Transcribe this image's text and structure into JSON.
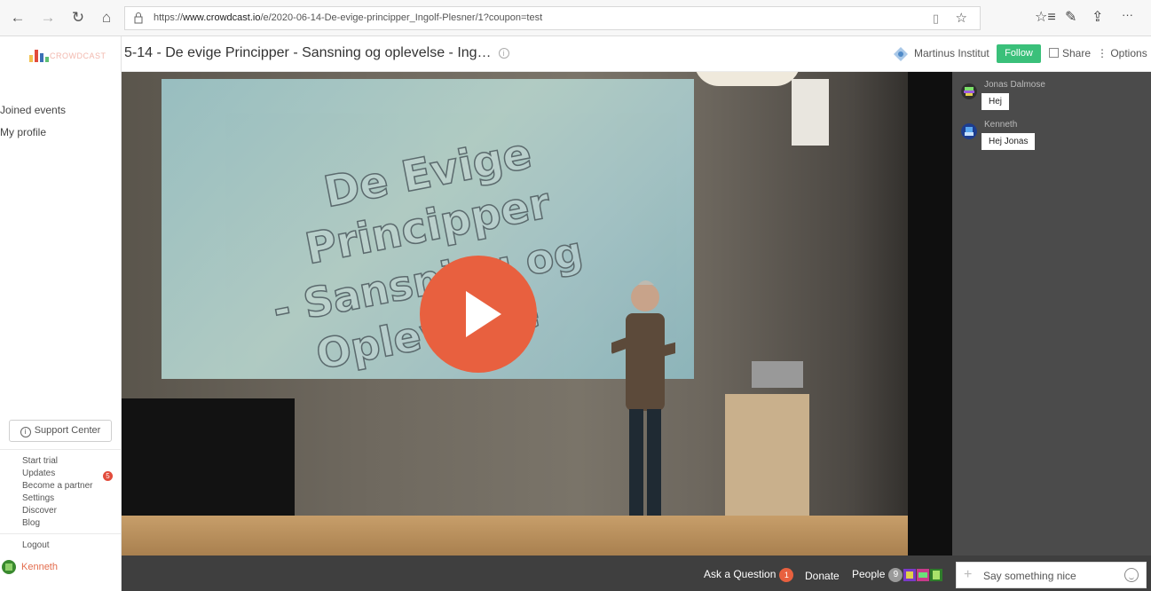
{
  "browser": {
    "back": "←",
    "forward": "→",
    "refresh": "↻",
    "home": "⌂",
    "url_prefix": "https://",
    "url_domain": "www.crowdcast.io",
    "url_path": "/e/2020-06-14-De-evige-principper_Ingolf-Plesner/1?coupon=test",
    "reading_view": "▯",
    "favorite": "☆",
    "favorites_hub": "☆≡",
    "pen": "✎",
    "share": "⇪",
    "more": "···"
  },
  "header": {
    "title": "5-14 - De evige Principper - Sansning og oplevelse - Ing…",
    "info": "i",
    "host_name": "Martinus Institut",
    "follow_label": "Follow",
    "share_label": "Share",
    "options_label": "Options"
  },
  "sidebar": {
    "logo_text": "CROWDCAST",
    "nav": [
      "Joined events",
      "My profile"
    ],
    "support_label": "Support Center",
    "links": [
      "Start trial",
      "Updates",
      "Become a partner",
      "Settings",
      "Discover",
      "Blog"
    ],
    "updates_count": "5",
    "logout_label": "Logout",
    "user_name": "Kenneth"
  },
  "video": {
    "slide_lines": [
      "De Evige",
      "Principper",
      "- Sansning og",
      "Oplevelse"
    ]
  },
  "chat": {
    "messages": [
      {
        "name": "Jonas Dalmose",
        "text": "Hej"
      },
      {
        "name": "Kenneth",
        "text": "Hej Jonas"
      }
    ],
    "input_placeholder": "Say something nice"
  },
  "bottom": {
    "ask_label": "Ask a Question",
    "ask_count": "1",
    "donate_label": "Donate",
    "people_label": "People",
    "people_count": "9"
  },
  "colors": {
    "accent": "#e8603f",
    "follow": "#3ac07a",
    "chat_bg": "#4b4b4b",
    "bottom_bg": "#3f3f3f"
  }
}
